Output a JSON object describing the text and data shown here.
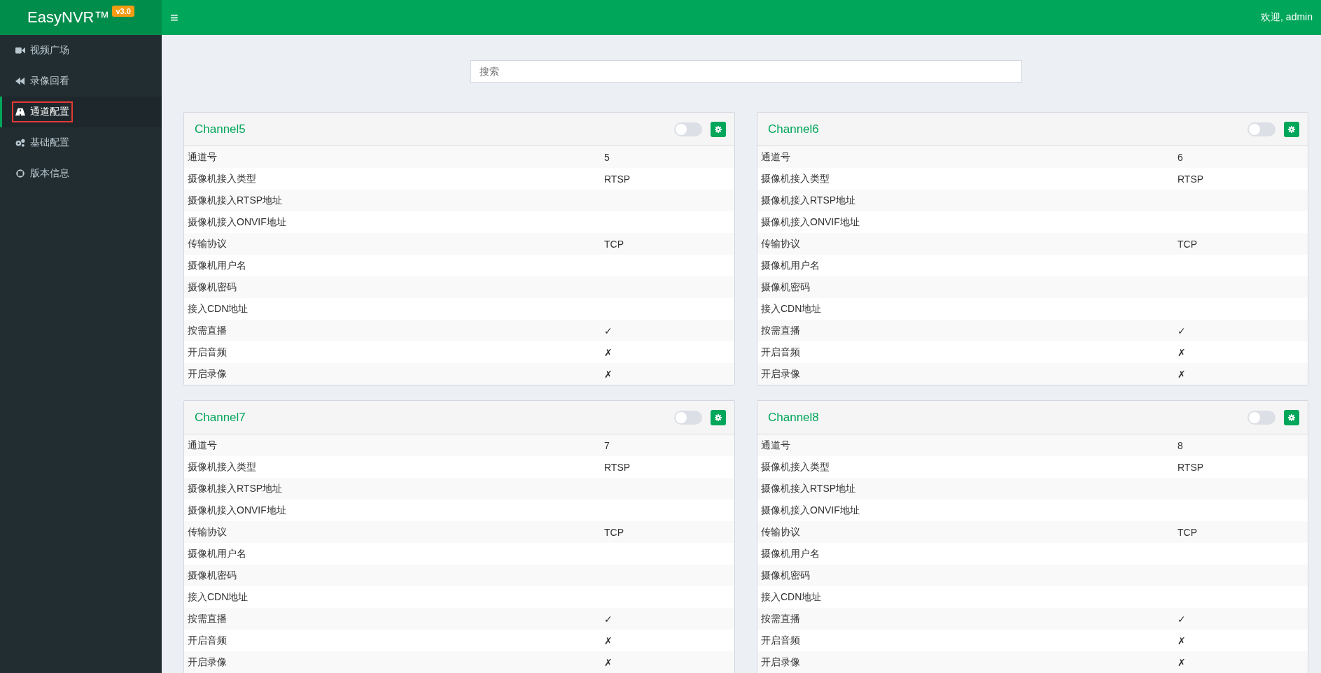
{
  "brand": {
    "name": "EasyNVR™",
    "version": "v3.0"
  },
  "header": {
    "menu_icon": "≡",
    "user": "欢迎, admin"
  },
  "sidebar": {
    "items": [
      {
        "label": "视频广场",
        "kind": "video",
        "selected": false
      },
      {
        "label": "录像回看",
        "kind": "playback",
        "selected": false
      },
      {
        "label": "通道配置",
        "kind": "channels",
        "selected": true
      },
      {
        "label": "基础配置",
        "kind": "settings",
        "selected": false
      },
      {
        "label": "版本信息",
        "kind": "about",
        "selected": false
      }
    ]
  },
  "search": {
    "placeholder": "搜索"
  },
  "channels": [
    {
      "title": "Channel5",
      "on": false,
      "rows": [
        [
          "通道号",
          "5"
        ],
        [
          "摄像机接入类型",
          "RTSP"
        ],
        [
          "摄像机接入RTSP地址",
          ""
        ],
        [
          "摄像机接入ONVIF地址",
          ""
        ],
        [
          "传输协议",
          "TCP"
        ],
        [
          "摄像机用户名",
          ""
        ],
        [
          "摄像机密码",
          ""
        ],
        [
          "接入CDN地址",
          ""
        ],
        [
          "按需直播",
          "✓"
        ],
        [
          "开启音频",
          "✗"
        ],
        [
          "开启录像",
          "✗"
        ]
      ]
    },
    {
      "title": "Channel6",
      "on": false,
      "rows": [
        [
          "通道号",
          "6"
        ],
        [
          "摄像机接入类型",
          "RTSP"
        ],
        [
          "摄像机接入RTSP地址",
          ""
        ],
        [
          "摄像机接入ONVIF地址",
          ""
        ],
        [
          "传输协议",
          "TCP"
        ],
        [
          "摄像机用户名",
          ""
        ],
        [
          "摄像机密码",
          ""
        ],
        [
          "接入CDN地址",
          ""
        ],
        [
          "按需直播",
          "✓"
        ],
        [
          "开启音频",
          "✗"
        ],
        [
          "开启录像",
          "✗"
        ]
      ]
    },
    {
      "title": "Channel7",
      "on": false,
      "rows": [
        [
          "通道号",
          "7"
        ],
        [
          "摄像机接入类型",
          "RTSP"
        ],
        [
          "摄像机接入RTSP地址",
          ""
        ],
        [
          "摄像机接入ONVIF地址",
          ""
        ],
        [
          "传输协议",
          "TCP"
        ],
        [
          "摄像机用户名",
          ""
        ],
        [
          "摄像机密码",
          ""
        ],
        [
          "接入CDN地址",
          ""
        ],
        [
          "按需直播",
          "✓"
        ],
        [
          "开启音频",
          "✗"
        ],
        [
          "开启录像",
          "✗"
        ]
      ]
    },
    {
      "title": "Channel8",
      "on": false,
      "rows": [
        [
          "通道号",
          "8"
        ],
        [
          "摄像机接入类型",
          "RTSP"
        ],
        [
          "摄像机接入RTSP地址",
          ""
        ],
        [
          "摄像机接入ONVIF地址",
          ""
        ],
        [
          "传输协议",
          "TCP"
        ],
        [
          "摄像机用户名",
          ""
        ],
        [
          "摄像机密码",
          ""
        ],
        [
          "接入CDN地址",
          ""
        ],
        [
          "按需直播",
          "✓"
        ],
        [
          "开启音频",
          "✗"
        ],
        [
          "开启录像",
          "✗"
        ]
      ]
    }
  ]
}
